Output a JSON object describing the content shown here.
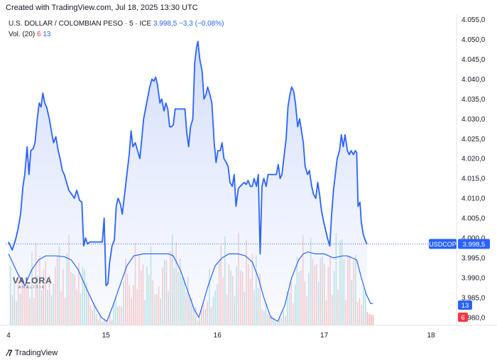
{
  "header": {
    "created_text": "Created with TradingView.com, Jul 18, 2025 13:30 UTC"
  },
  "legend": {
    "symbol_text": "U.S. DOLLAR / COLOMBIAN PESO · 5 · ICE",
    "price_text": "3.998,5 −3,3 (−0,08%)",
    "vol_label": "Vol. (20)",
    "vol_down": "6",
    "vol_up": "13"
  },
  "watermark": {
    "brand": "VALORA",
    "sub": "ANALITIK"
  },
  "footer": {
    "brand": "TradingView"
  },
  "colors": {
    "line": "#2962ff",
    "up": "#26a69a",
    "down": "#ef5350",
    "vol_ma": "#2962ff",
    "fill": "#dfe6fb"
  },
  "chart_data": {
    "type": "area",
    "title": "U.S. DOLLAR / COLOMBIAN PESO · 5 · ICE",
    "ylim": [
      3978.0,
      4056.0
    ],
    "xlim": [
      0,
      100
    ],
    "x_ticks": [
      {
        "label": "4",
        "x": 0
      },
      {
        "label": "15",
        "x": 21
      },
      {
        "label": "16",
        "x": 45
      },
      {
        "label": "17",
        "x": 68
      },
      {
        "label": "18",
        "x": 91
      }
    ],
    "y_ticks": [
      {
        "label": "3.980,0",
        "value": 3980
      },
      {
        "label": "3.985,0",
        "value": 3985
      },
      {
        "label": "3.990,0",
        "value": 3990
      },
      {
        "label": "3.995,0",
        "value": 3995
      },
      {
        "label": "4.000,0",
        "value": 4000
      },
      {
        "label": "4.005,0",
        "value": 4005
      },
      {
        "label": "4.010,0",
        "value": 4010
      },
      {
        "label": "4.015,0",
        "value": 4015
      },
      {
        "label": "4.020,0",
        "value": 4020
      },
      {
        "label": "4.025,0",
        "value": 4025
      },
      {
        "label": "4.030,0",
        "value": 4030
      },
      {
        "label": "4.035,0",
        "value": 4035
      },
      {
        "label": "4.040,0",
        "value": 4040
      },
      {
        "label": "4.045,0",
        "value": 4045
      },
      {
        "label": "4.050,0",
        "value": 4050
      },
      {
        "label": "4.055,0",
        "value": 4055
      }
    ],
    "last_price": {
      "label": "USDCOP",
      "value": 3998.5,
      "value_text": "3.998,5"
    },
    "vol_badges": {
      "up_text": "13",
      "down_text": "6"
    },
    "price_points": [
      [
        0.0,
        3999.0
      ],
      [
        0.8,
        3997.0
      ],
      [
        1.5,
        3999.5
      ],
      [
        2.0,
        4002.0
      ],
      [
        2.6,
        4006.0
      ],
      [
        3.1,
        4013.0
      ],
      [
        3.5,
        4016.0
      ],
      [
        4.0,
        4023.0
      ],
      [
        4.4,
        4016.0
      ],
      [
        4.8,
        4022.0
      ],
      [
        5.3,
        4022.5
      ],
      [
        5.7,
        4024.0
      ],
      [
        6.2,
        4030.0
      ],
      [
        6.6,
        4034.0
      ],
      [
        7.0,
        4033.0
      ],
      [
        7.4,
        4036.5
      ],
      [
        7.8,
        4034.0
      ],
      [
        8.2,
        4033.0
      ],
      [
        8.8,
        4030.0
      ],
      [
        9.3,
        4026.5
      ],
      [
        9.7,
        4024.0
      ],
      [
        10.2,
        4025.5
      ],
      [
        10.7,
        4022.0
      ],
      [
        11.1,
        4020.0
      ],
      [
        11.6,
        4017.0
      ],
      [
        12.0,
        4016.0
      ],
      [
        12.5,
        4014.0
      ],
      [
        13.0,
        4012.0
      ],
      [
        13.6,
        4011.0
      ],
      [
        14.2,
        4010.0
      ],
      [
        14.7,
        4012.0
      ],
      [
        15.3,
        4009.5
      ],
      [
        15.8,
        4009.0
      ],
      [
        16.2,
        3998.0
      ],
      [
        16.6,
        4000.0
      ],
      [
        17.0,
        3998.5
      ],
      [
        17.5,
        3999.0
      ],
      [
        18.0,
        3999.0
      ],
      [
        18.6,
        3999.0
      ],
      [
        19.2,
        3999.0
      ],
      [
        19.7,
        3999.0
      ],
      [
        20.2,
        3999.0
      ],
      [
        20.6,
        4005.0
      ],
      [
        21.0,
        3988.0
      ],
      [
        21.4,
        3988.5
      ],
      [
        21.8,
        3994.0
      ],
      [
        22.3,
        3998.0
      ],
      [
        22.8,
        3999.5
      ],
      [
        23.2,
        4008.0
      ],
      [
        23.6,
        4010.0
      ],
      [
        24.1,
        4008.5
      ],
      [
        24.5,
        4006.0
      ],
      [
        25.0,
        4011.0
      ],
      [
        25.5,
        4016.0
      ],
      [
        26.0,
        4021.0
      ],
      [
        26.4,
        4027.0
      ],
      [
        26.8,
        4023.0
      ],
      [
        27.3,
        4024.0
      ],
      [
        27.8,
        4022.0
      ],
      [
        28.3,
        4020.0
      ],
      [
        28.7,
        4025.0
      ],
      [
        29.1,
        4030.0
      ],
      [
        29.6,
        4033.0
      ],
      [
        30.0,
        4035.5
      ],
      [
        30.4,
        4038.0
      ],
      [
        30.9,
        4040.0
      ],
      [
        31.3,
        4039.5
      ],
      [
        31.7,
        4040.5
      ],
      [
        32.1,
        4038.5
      ],
      [
        32.6,
        4034.0
      ],
      [
        33.0,
        4035.0
      ],
      [
        33.5,
        4032.0
      ],
      [
        33.9,
        4034.0
      ],
      [
        34.3,
        4032.5
      ],
      [
        34.7,
        4028.0
      ],
      [
        35.1,
        4028.0
      ],
      [
        35.5,
        4028.5
      ],
      [
        35.9,
        4032.5
      ],
      [
        36.4,
        4032.5
      ],
      [
        36.8,
        4032.5
      ],
      [
        37.4,
        4032.5
      ],
      [
        38.0,
        4032.5
      ],
      [
        38.4,
        4026.5
      ],
      [
        38.8,
        4023.0
      ],
      [
        39.2,
        4028.0
      ],
      [
        39.7,
        4030.0
      ],
      [
        40.1,
        4044.0
      ],
      [
        40.5,
        4048.0
      ],
      [
        40.8,
        4049.5
      ],
      [
        41.2,
        4045.0
      ],
      [
        41.7,
        4042.0
      ],
      [
        42.1,
        4035.0
      ],
      [
        42.5,
        4036.0
      ],
      [
        42.9,
        4038.0
      ],
      [
        43.4,
        4036.0
      ],
      [
        43.8,
        4034.0
      ],
      [
        44.3,
        4024.0
      ],
      [
        44.7,
        4019.0
      ],
      [
        45.1,
        4022.0
      ],
      [
        45.6,
        4022.0
      ],
      [
        46.0,
        4024.0
      ],
      [
        46.4,
        4020.0
      ],
      [
        46.9,
        4019.0
      ],
      [
        47.3,
        4018.0
      ],
      [
        47.7,
        4014.0
      ],
      [
        48.2,
        4013.0
      ],
      [
        48.6,
        4016.0
      ],
      [
        49.0,
        4008.0
      ],
      [
        49.5,
        4012.5
      ],
      [
        49.9,
        4013.0
      ],
      [
        50.3,
        4013.5
      ],
      [
        50.8,
        4014.0
      ],
      [
        51.2,
        4013.5
      ],
      [
        51.6,
        4014.5
      ],
      [
        52.1,
        4013.0
      ],
      [
        52.5,
        4013.0
      ],
      [
        52.9,
        4015.0
      ],
      [
        53.4,
        4013.0
      ],
      [
        53.8,
        4016.0
      ],
      [
        54.2,
        3996.0
      ],
      [
        54.6,
        4013.0
      ],
      [
        55.0,
        4015.0
      ],
      [
        55.5,
        4013.0
      ],
      [
        55.9,
        4016.0
      ],
      [
        56.4,
        4016.0
      ],
      [
        56.8,
        4016.0
      ],
      [
        57.2,
        4016.0
      ],
      [
        57.7,
        4016.0
      ],
      [
        58.1,
        4018.5
      ],
      [
        58.5,
        4015.0
      ],
      [
        58.9,
        4016.0
      ],
      [
        59.3,
        4020.0
      ],
      [
        59.8,
        4025.0
      ],
      [
        60.2,
        4033.0
      ],
      [
        60.6,
        4036.0
      ],
      [
        61.0,
        4038.0
      ],
      [
        61.4,
        4037.0
      ],
      [
        61.8,
        4034.0
      ],
      [
        62.3,
        4028.0
      ],
      [
        62.7,
        4030.0
      ],
      [
        63.1,
        4027.0
      ],
      [
        63.5,
        4024.0
      ],
      [
        63.9,
        4018.0
      ],
      [
        64.4,
        4016.0
      ],
      [
        64.8,
        4017.0
      ],
      [
        65.3,
        4013.0
      ],
      [
        65.7,
        4011.0
      ],
      [
        66.2,
        4010.0
      ],
      [
        66.6,
        4014.0
      ],
      [
        67.0,
        4011.0
      ],
      [
        67.4,
        4007.0
      ],
      [
        67.9,
        4004.0
      ],
      [
        68.3,
        4002.0
      ],
      [
        68.7,
        4000.0
      ],
      [
        69.2,
        3998.0
      ],
      [
        69.6,
        4006.0
      ],
      [
        70.0,
        4012.0
      ],
      [
        70.4,
        4016.0
      ],
      [
        70.8,
        4020.0
      ],
      [
        71.3,
        4022.0
      ],
      [
        71.7,
        4026.0
      ],
      [
        72.1,
        4023.0
      ],
      [
        72.5,
        4026.0
      ],
      [
        73.0,
        4022.0
      ],
      [
        73.4,
        4021.0
      ],
      [
        73.8,
        4022.0
      ],
      [
        74.3,
        4021.0
      ],
      [
        74.7,
        4022.0
      ],
      [
        75.0,
        4021.5
      ],
      [
        75.3,
        4008.0
      ],
      [
        75.7,
        4009.0
      ],
      [
        76.0,
        4004.0
      ],
      [
        76.4,
        4001.0
      ],
      [
        76.8,
        3999.5
      ],
      [
        77.2,
        3998.5
      ]
    ],
    "volume_ma_points": [
      [
        0.0,
        3996.0
      ],
      [
        2.0,
        3991.0
      ],
      [
        3.5,
        3988.0
      ],
      [
        5.0,
        3992.0
      ],
      [
        6.5,
        3994.5
      ],
      [
        8.0,
        3995.5
      ],
      [
        10.0,
        3995.5
      ],
      [
        12.0,
        3995.3
      ],
      [
        13.5,
        3994.5
      ],
      [
        15.0,
        3992.0
      ],
      [
        16.5,
        3988.0
      ],
      [
        18.5,
        3983.0
      ],
      [
        20.0,
        3980.0
      ],
      [
        21.2,
        3979.0
      ],
      [
        22.5,
        3983.0
      ],
      [
        24.0,
        3988.0
      ],
      [
        25.5,
        3993.0
      ],
      [
        27.0,
        3995.5
      ],
      [
        29.0,
        3996.0
      ],
      [
        31.0,
        3996.0
      ],
      [
        33.0,
        3996.0
      ],
      [
        34.5,
        3996.0
      ],
      [
        35.5,
        3995.5
      ],
      [
        37.0,
        3992.0
      ],
      [
        38.5,
        3987.0
      ],
      [
        40.0,
        3982.0
      ],
      [
        41.0,
        3980.0
      ],
      [
        42.0,
        3984.0
      ],
      [
        43.0,
        3988.0
      ],
      [
        44.5,
        3993.0
      ],
      [
        46.0,
        3995.0
      ],
      [
        47.5,
        3996.0
      ],
      [
        49.5,
        3996.0
      ],
      [
        51.0,
        3995.5
      ],
      [
        52.5,
        3994.0
      ],
      [
        53.8,
        3990.0
      ],
      [
        55.0,
        3985.0
      ],
      [
        56.5,
        3980.0
      ],
      [
        58.0,
        3979.0
      ],
      [
        59.5,
        3983.0
      ],
      [
        61.0,
        3990.0
      ],
      [
        62.5,
        3994.5
      ],
      [
        63.5,
        3996.0
      ],
      [
        64.5,
        3996.5
      ],
      [
        66.0,
        3996.0
      ],
      [
        68.0,
        3996.0
      ],
      [
        70.0,
        3995.0
      ],
      [
        72.0,
        3995.5
      ],
      [
        73.0,
        3995.5
      ],
      [
        74.0,
        3995.0
      ],
      [
        75.0,
        3994.5
      ],
      [
        76.0,
        3990.0
      ],
      [
        77.0,
        3986.0
      ],
      [
        78.0,
        3983.5
      ],
      [
        78.5,
        3983.5
      ]
    ]
  }
}
